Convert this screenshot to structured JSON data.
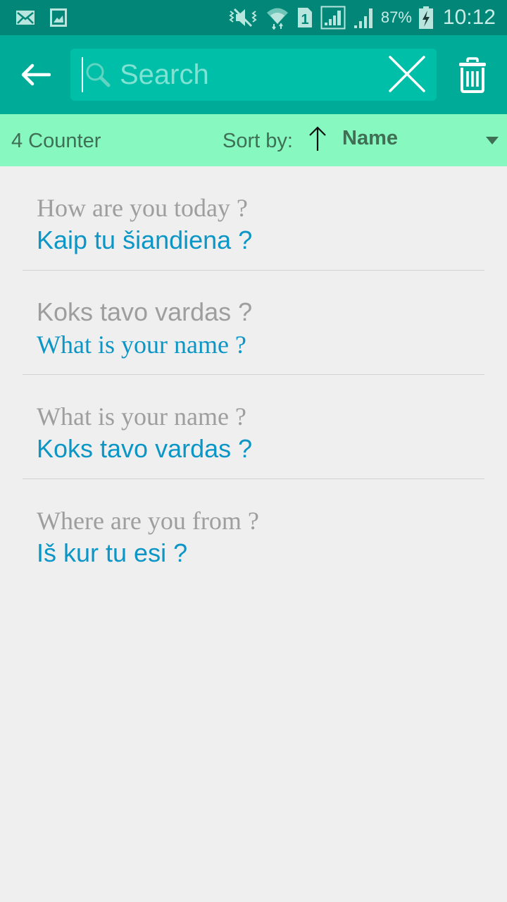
{
  "status_bar": {
    "left_icons": [
      "mail-icon",
      "image-icon"
    ],
    "right_icons": [
      "vibrate-mute-icon",
      "wifi-icon",
      "sim-1-icon",
      "signal-sim1-icon",
      "signal-sim2-icon",
      "battery-charging-icon"
    ],
    "sim_label": "1",
    "battery_pct": "87%",
    "time": "10:12"
  },
  "app_bar": {
    "back_icon": "arrow-back-icon",
    "search": {
      "value": "",
      "placeholder": "Search",
      "icon": "search-icon"
    },
    "clear_icon": "close-icon",
    "delete_icon": "trash-icon"
  },
  "sort_bar": {
    "counter": "4 Counter",
    "sort_label": "Sort by:",
    "sort_direction_icon": "arrow-up-icon",
    "sort_value": "Name"
  },
  "list": {
    "items": [
      {
        "source": "How are you today ?",
        "translation": "Kaip tu šiandiena ?",
        "source_font": "serif",
        "translation_font": "sans"
      },
      {
        "source": "Koks tavo vardas ?",
        "translation": "What is your name ?",
        "source_font": "sans",
        "translation_font": "serif"
      },
      {
        "source": "What is your name ?",
        "translation": "Koks tavo vardas ?",
        "source_font": "serif",
        "translation_font": "sans"
      },
      {
        "source": "Where are you from ?",
        "translation": "Iš kur tu esi ?",
        "source_font": "serif",
        "translation_font": "sans"
      }
    ]
  },
  "colors": {
    "status_bar": "#028677",
    "app_bar": "#00ab97",
    "search_box": "#00bfa8",
    "sort_bar": "#86f8c0",
    "source_text": "#9e9e9e",
    "translation_text": "#0b96c6",
    "background": "#efefef"
  }
}
